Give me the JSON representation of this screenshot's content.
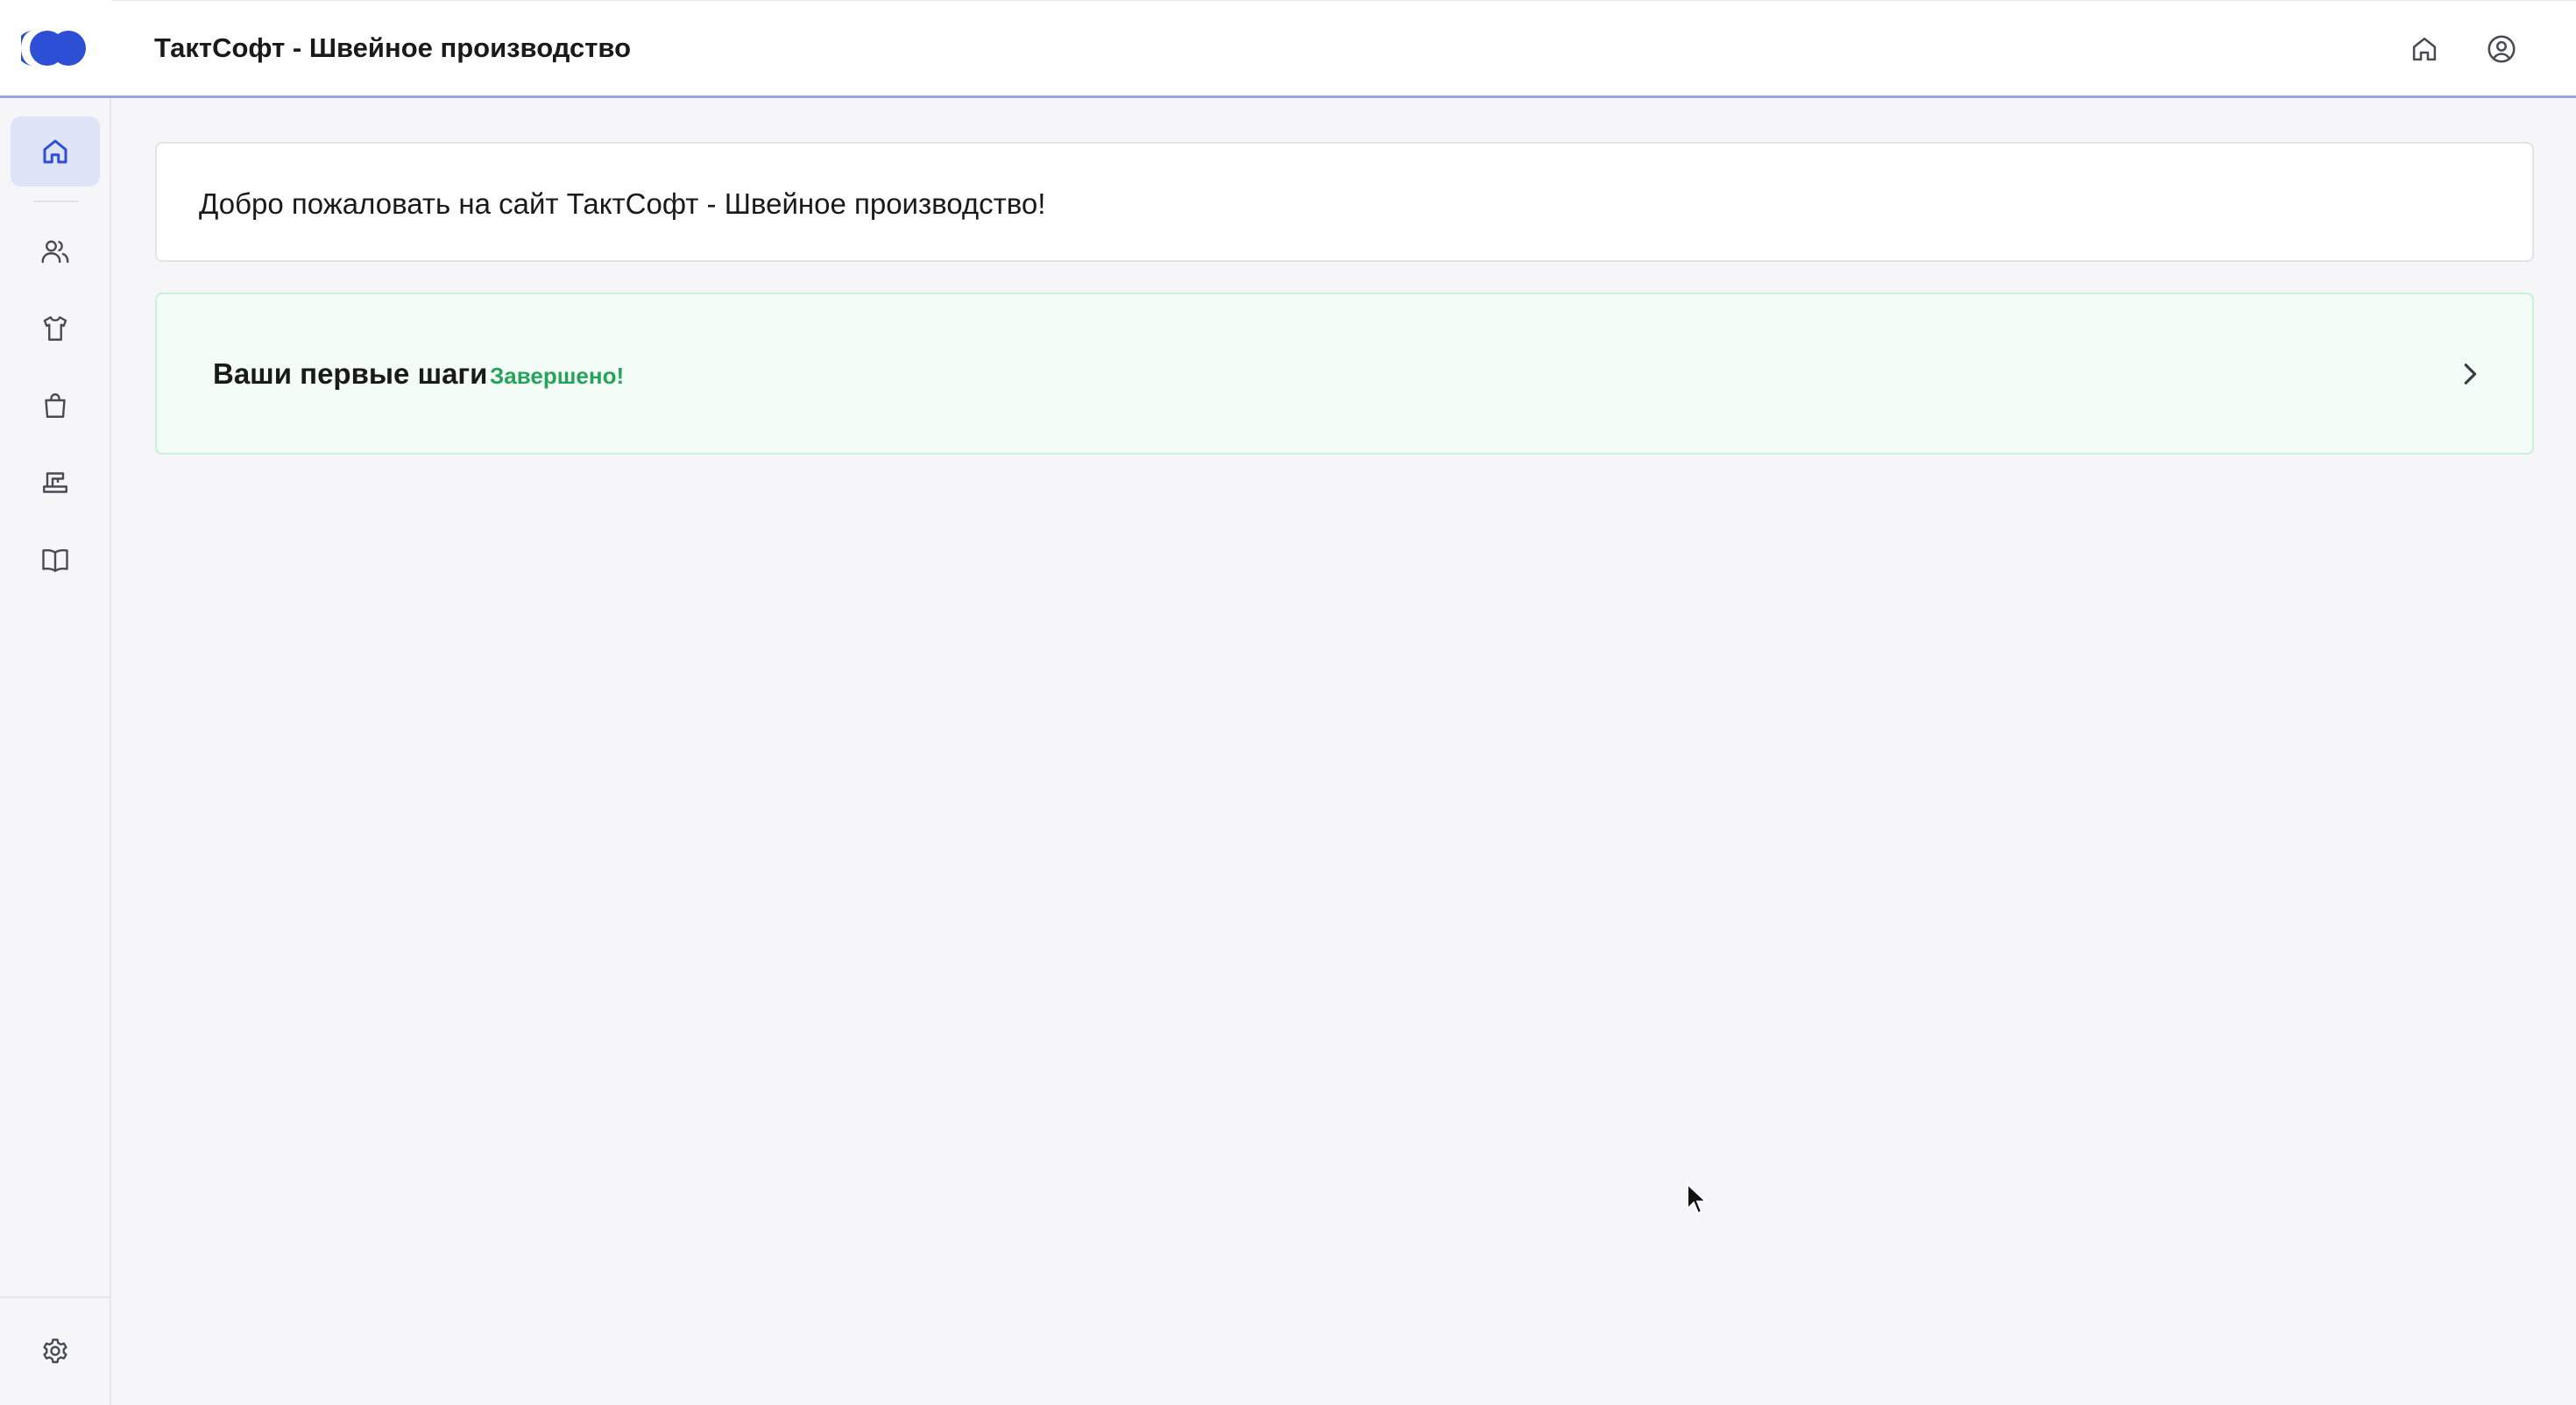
{
  "app": {
    "title": "ТактСофт - Швейное производство"
  },
  "sidebar": {
    "logo": "logo-icon",
    "items": [
      {
        "name": "home",
        "icon": "home-icon",
        "active": true
      },
      {
        "name": "users",
        "icon": "users-icon",
        "active": false
      },
      {
        "name": "products",
        "icon": "tshirt-icon",
        "active": false
      },
      {
        "name": "orders",
        "icon": "shopping-bag-icon",
        "active": false
      },
      {
        "name": "production",
        "icon": "sewing-machine-icon",
        "active": false
      },
      {
        "name": "directory",
        "icon": "book-icon",
        "active": false
      }
    ],
    "settings_icon": "gear-icon"
  },
  "header": {
    "home_icon": "home-icon",
    "account_icon": "user-circle-icon"
  },
  "main": {
    "welcome": "Добро пожаловать на сайт ТактСофт - Швейное производство!",
    "steps": {
      "title": "Ваши первые шаги",
      "status": "Завершено!",
      "icon": "chevron-right-icon"
    }
  },
  "colors": {
    "accent": "#2d4fd6",
    "active_nav_bg": "#dfe3f7",
    "success": "#26a35a",
    "success_bg": "#f3fcf7",
    "header_border": "#9aa3e6"
  }
}
